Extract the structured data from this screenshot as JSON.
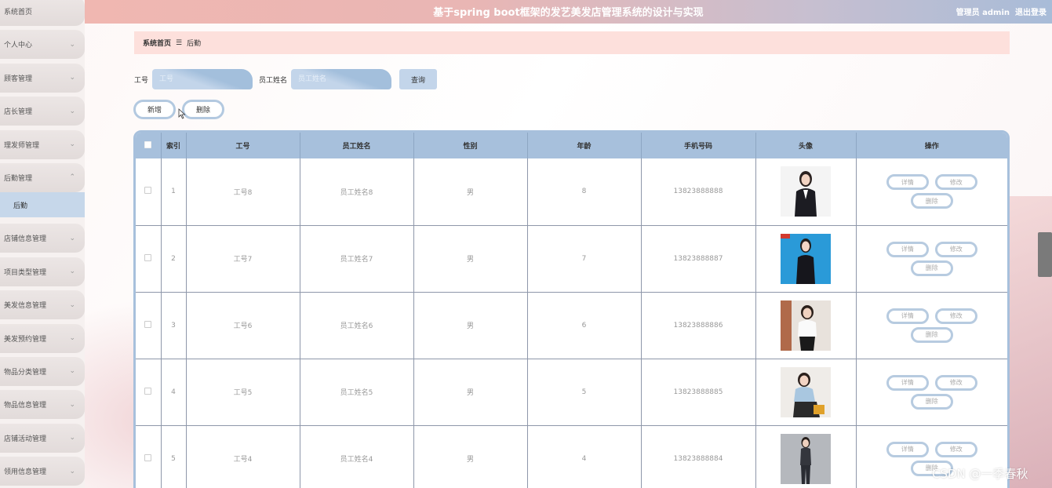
{
  "header": {
    "title": "基于spring boot框架的发艺美发店管理系统的设计与实现",
    "user": "管理员 admin",
    "logout": "退出登录"
  },
  "sidebar": {
    "items": [
      {
        "label": "系统首页",
        "chevron": false
      },
      {
        "label": "个人中心",
        "chevron": true
      },
      {
        "label": "顾客管理",
        "chevron": true
      },
      {
        "label": "店长管理",
        "chevron": true
      },
      {
        "label": "理发师管理",
        "chevron": true
      },
      {
        "label": "后勤管理",
        "chevron": true,
        "expanded": true
      },
      {
        "label": "店铺信息管理",
        "chevron": true
      },
      {
        "label": "项目类型管理",
        "chevron": true
      },
      {
        "label": "美发信息管理",
        "chevron": true
      },
      {
        "label": "美发预约管理",
        "chevron": true
      },
      {
        "label": "物品分类管理",
        "chevron": true
      },
      {
        "label": "物品信息管理",
        "chevron": true
      },
      {
        "label": "店铺活动管理",
        "chevron": true
      },
      {
        "label": "领用信息管理",
        "chevron": true
      }
    ],
    "submenu": {
      "label": "后勤"
    }
  },
  "breadcrumb": {
    "home": "系统首页",
    "sep": "☰",
    "current": "后勤"
  },
  "search": {
    "id_label": "工号",
    "id_placeholder": "工号",
    "name_label": "员工姓名",
    "name_placeholder": "员工姓名",
    "button": "查询"
  },
  "actions": {
    "add": "新增",
    "delete": "删除"
  },
  "table": {
    "headers": [
      "",
      "索引",
      "工号",
      "员工姓名",
      "性别",
      "年龄",
      "手机号码",
      "头像",
      "操作"
    ],
    "rows": [
      {
        "index": "1",
        "id": "工号8",
        "name": "员工姓名8",
        "gender": "男",
        "age": "8",
        "phone": "13823888888"
      },
      {
        "index": "2",
        "id": "工号7",
        "name": "员工姓名7",
        "gender": "男",
        "age": "7",
        "phone": "13823888887"
      },
      {
        "index": "3",
        "id": "工号6",
        "name": "员工姓名6",
        "gender": "男",
        "age": "6",
        "phone": "13823888886"
      },
      {
        "index": "4",
        "id": "工号5",
        "name": "员工姓名5",
        "gender": "男",
        "age": "5",
        "phone": "13823888885"
      },
      {
        "index": "5",
        "id": "工号4",
        "name": "员工姓名4",
        "gender": "男",
        "age": "4",
        "phone": "13823888884"
      }
    ],
    "row_actions": {
      "detail": "详情",
      "edit": "修改",
      "delete": "删除"
    }
  },
  "watermark": "CSDN @一季春秋",
  "colors": {
    "accent": "#a7c0dc",
    "breadcrumb_bg": "#fde0dc",
    "submenu_bg": "#c6d7ea"
  }
}
